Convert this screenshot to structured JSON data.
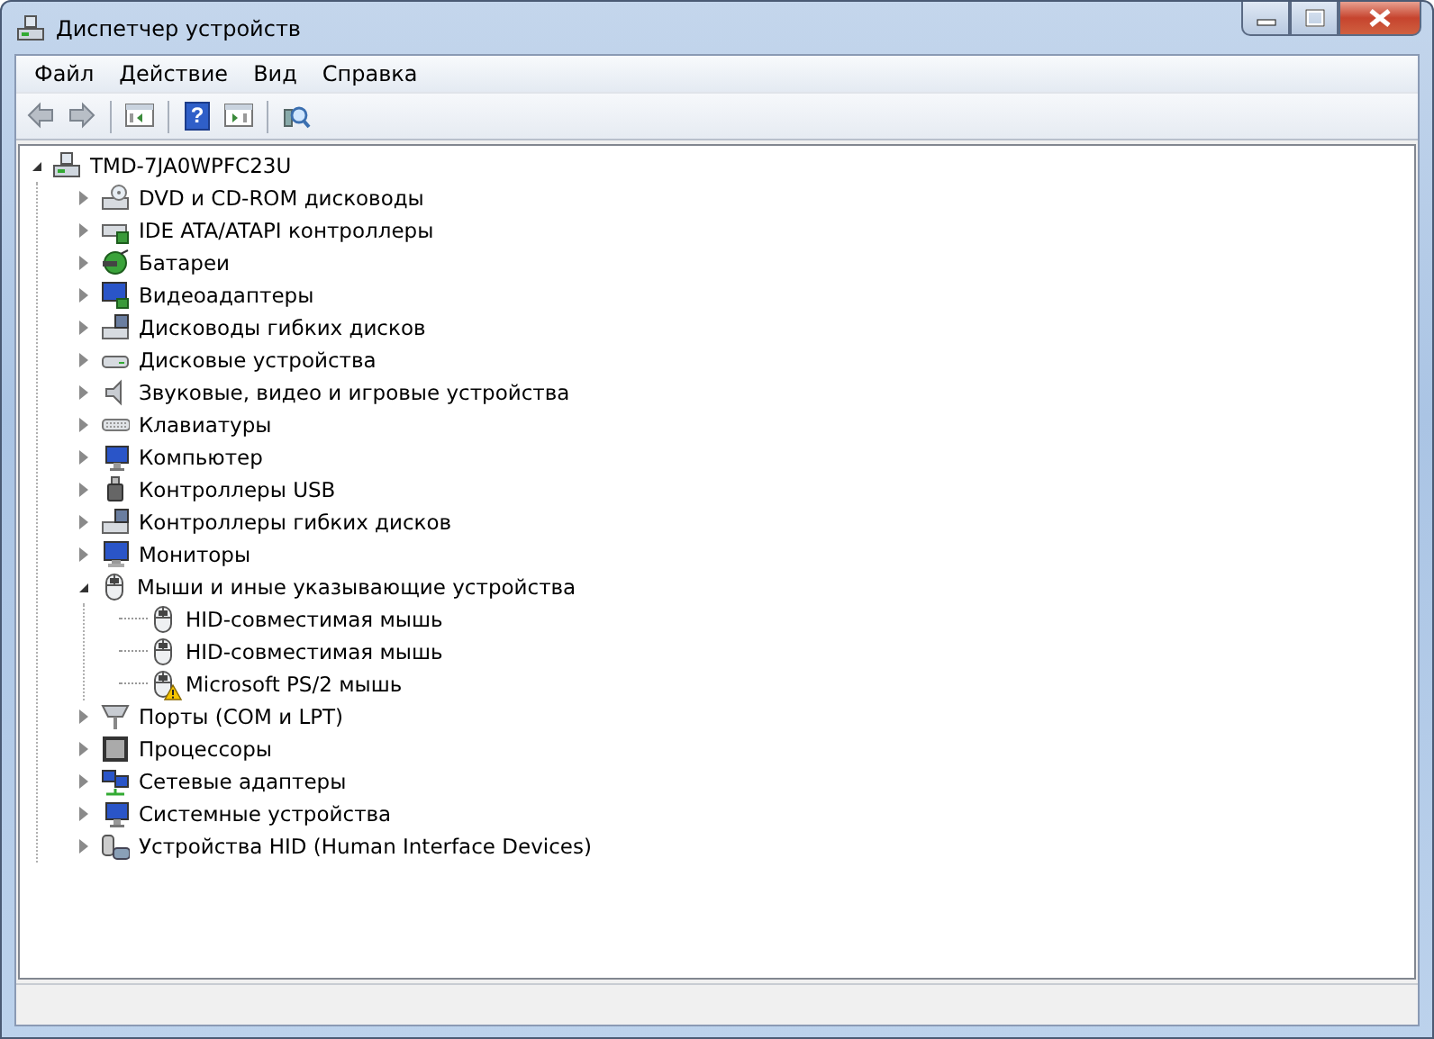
{
  "window": {
    "title": "Диспетчер устройств"
  },
  "menu": [
    "Файл",
    "Действие",
    "Вид",
    "Справка"
  ],
  "toolbar": [
    {
      "kind": "back"
    },
    {
      "kind": "forward"
    },
    {
      "kind": "sep"
    },
    {
      "kind": "console"
    },
    {
      "kind": "sep"
    },
    {
      "kind": "help",
      "glyph": "?"
    },
    {
      "kind": "action"
    },
    {
      "kind": "sep"
    },
    {
      "kind": "scan"
    }
  ],
  "tree": {
    "label": "TMD-7JA0WPFC23U",
    "kind": "computer",
    "expanded": true,
    "children": [
      {
        "label": "DVD и CD-ROM дисководы",
        "kind": "dvd",
        "expanded": false
      },
      {
        "label": "IDE ATA/ATAPI контроллеры",
        "kind": "ide",
        "expanded": false
      },
      {
        "label": "Батареи",
        "kind": "battery",
        "expanded": false
      },
      {
        "label": "Видеоадаптеры",
        "kind": "video",
        "expanded": false
      },
      {
        "label": "Дисководы гибких дисков",
        "kind": "floppy",
        "expanded": false
      },
      {
        "label": "Дисковые устройства",
        "kind": "disk",
        "expanded": false
      },
      {
        "label": "Звуковые, видео и игровые устройства",
        "kind": "sound",
        "expanded": false
      },
      {
        "label": "Клавиатуры",
        "kind": "keyboard",
        "expanded": false
      },
      {
        "label": "Компьютер",
        "kind": "pc",
        "expanded": false
      },
      {
        "label": "Контроллеры USB",
        "kind": "usb",
        "expanded": false
      },
      {
        "label": "Контроллеры гибких дисков",
        "kind": "floppy",
        "expanded": false
      },
      {
        "label": "Мониторы",
        "kind": "monitor",
        "expanded": false
      },
      {
        "label": "Мыши и иные указывающие устройства",
        "kind": "mouse",
        "expanded": true,
        "children": [
          {
            "label": "HID-совместимая мышь",
            "kind": "mouse",
            "warning": false
          },
          {
            "label": "HID-совместимая мышь",
            "kind": "mouse",
            "warning": false
          },
          {
            "label": "Microsoft PS/2 мышь",
            "kind": "mouse",
            "warning": true
          }
        ]
      },
      {
        "label": "Порты (COM и LPT)",
        "kind": "port",
        "expanded": false
      },
      {
        "label": "Процессоры",
        "kind": "cpu",
        "expanded": false
      },
      {
        "label": "Сетевые адаптеры",
        "kind": "network",
        "expanded": false
      },
      {
        "label": "Системные устройства",
        "kind": "pc",
        "expanded": false
      },
      {
        "label": "Устройства HID (Human Interface Devices)",
        "kind": "hid",
        "expanded": false
      }
    ]
  }
}
